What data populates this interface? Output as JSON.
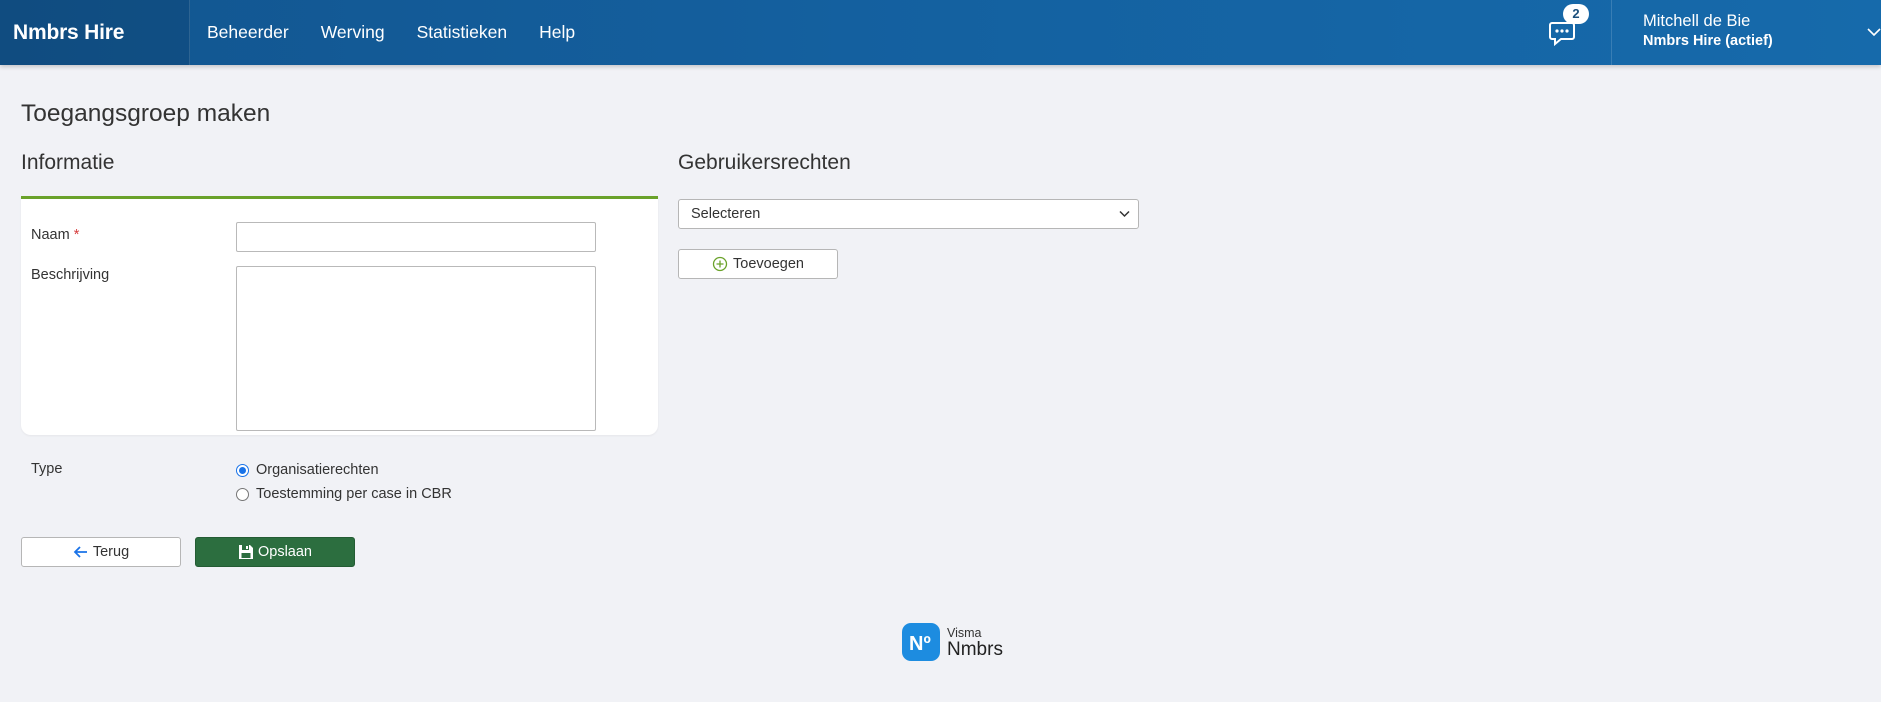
{
  "header": {
    "brand": "Nmbrs Hire",
    "nav": [
      {
        "label": "Beheerder"
      },
      {
        "label": "Werving"
      },
      {
        "label": "Statistieken"
      },
      {
        "label": "Help"
      }
    ],
    "chat_badge": "2",
    "user_name": "Mitchell de Bie",
    "user_org": "Nmbrs Hire (actief)"
  },
  "page": {
    "title": "Toegangsgroep maken"
  },
  "info": {
    "section_title": "Informatie",
    "name_label": "Naam",
    "required_mark": "*",
    "name_value": "",
    "description_label": "Beschrijving",
    "description_value": ""
  },
  "type": {
    "label": "Type",
    "options": [
      {
        "label": "Organisatierechten",
        "checked": true
      },
      {
        "label": "Toestemming per case in CBR",
        "checked": false
      }
    ]
  },
  "rights": {
    "section_title": "Gebruikersrechten",
    "select_value": "Selecteren",
    "add_label": "Toevoegen"
  },
  "actions": {
    "back_label": "Terug",
    "save_label": "Opslaan"
  },
  "footer": {
    "logo_glyph": "Nº",
    "company_small": "Visma",
    "company_big": "Nmbrs"
  },
  "colors": {
    "header": "#14609f",
    "accent_green": "#6aa22a",
    "save_button": "#2c6e3f",
    "radio_checked": "#1a73e8",
    "logo_blue": "#1d8ce0"
  }
}
